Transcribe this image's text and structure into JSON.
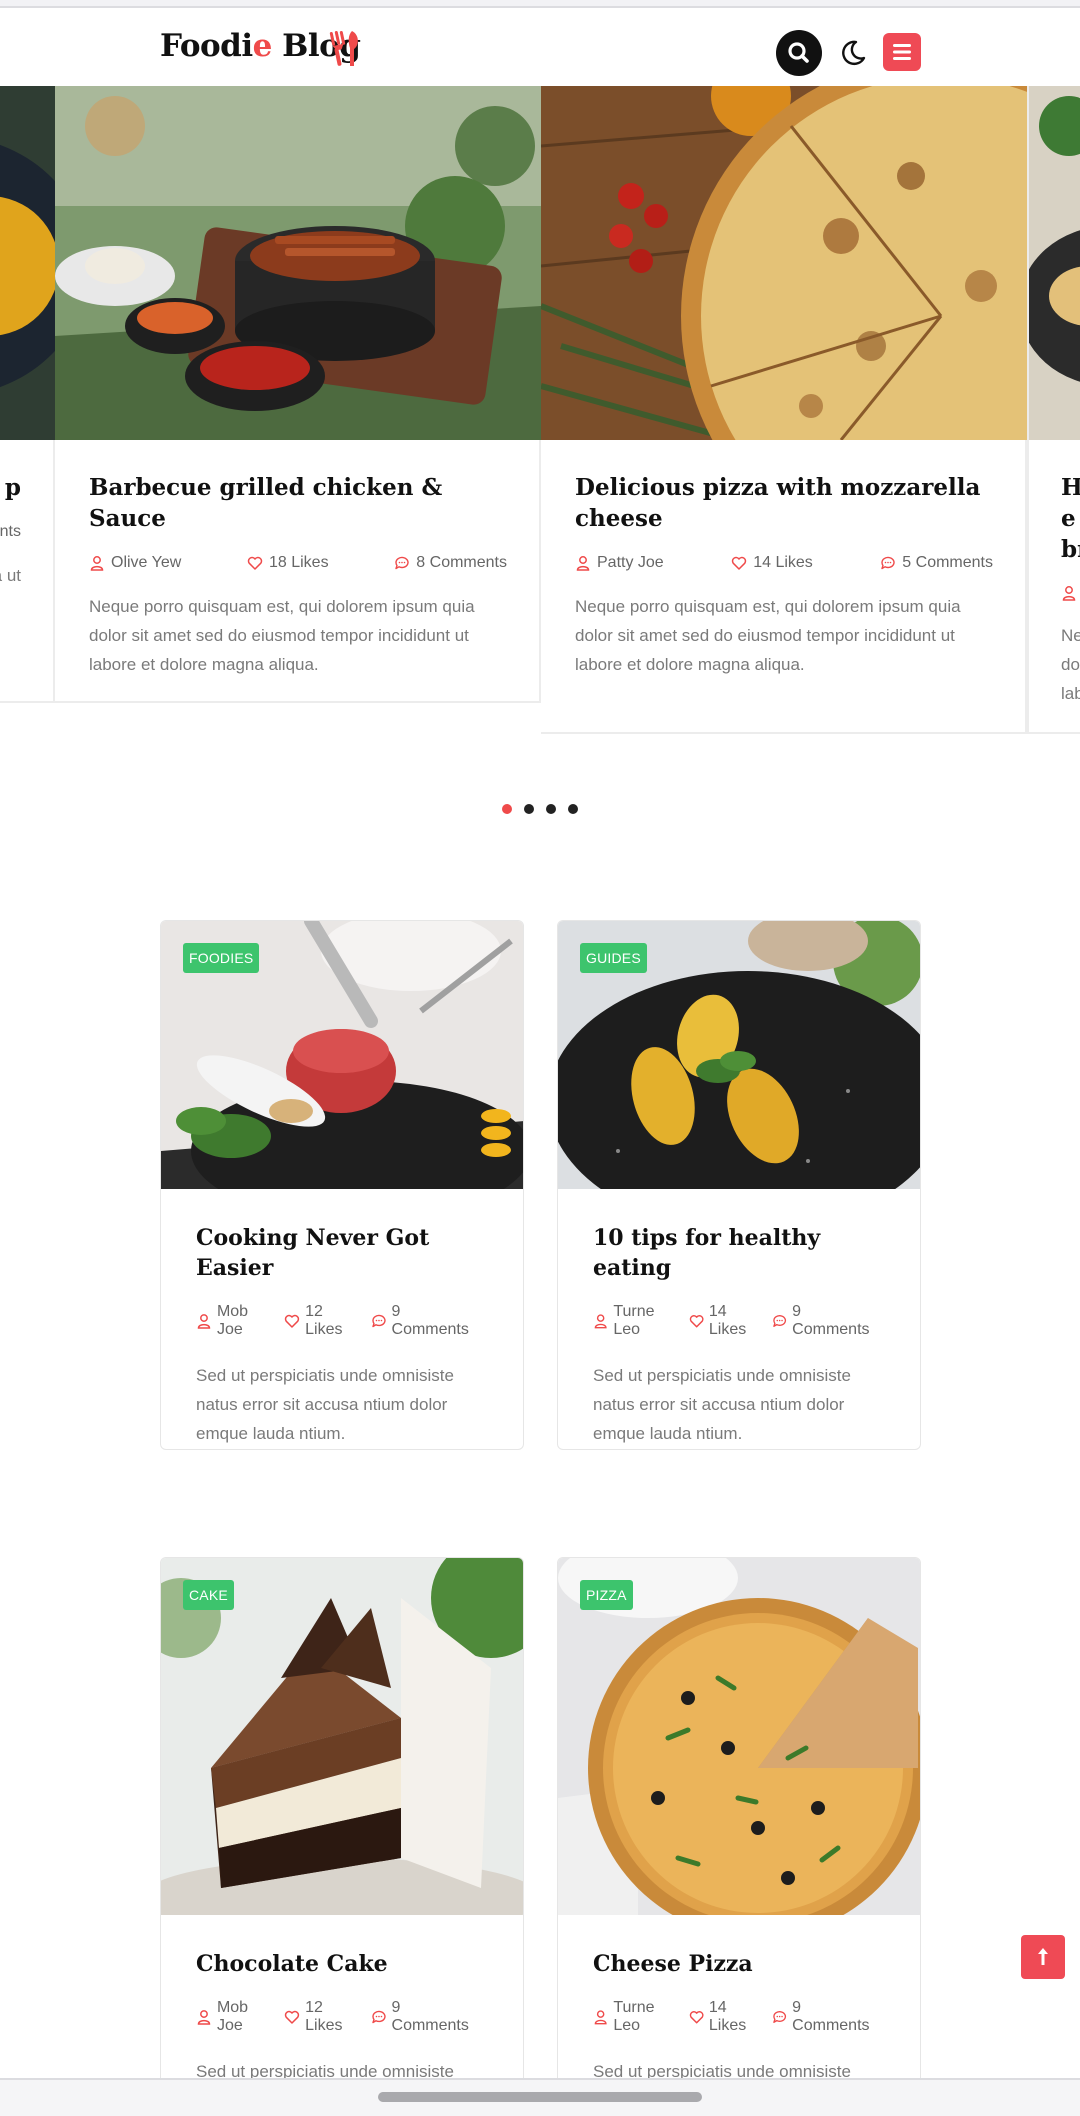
{
  "header": {
    "logo_main": "Foodi",
    "logo_accent": "e",
    "logo_end": " Blog",
    "icons": [
      "utensils-icon",
      "search-icon",
      "moon-icon",
      "menu-icon"
    ],
    "accent_color": "#ef4a55"
  },
  "slider": {
    "slides": [
      {
        "title": "Barbecue grilled chicken & Sauce",
        "author": "Olive Yew",
        "likes": "18 Likes",
        "comments": "8 Comments",
        "excerpt": "Neque porro quisquam est, qui dolorem ipsum quia dolor sit amet sed do eiusmod tempor incididunt ut labore et dolore magna aliqua."
      },
      {
        "title": "Delicious pizza with mozzarella cheese",
        "author": "Patty Joe",
        "likes": "14 Likes",
        "comments": "5 Comments",
        "excerpt": "Neque porro quisquam est, qui dolorem ipsum quia dolor sit amet sed do eiusmod tempor incididunt ut labore et dolore magna aliqua."
      }
    ],
    "left_peek": {
      "title": "p",
      "comments": "nts",
      "excerpt": "a ut"
    },
    "right_peek": {
      "title": "He br",
      "excerpt": "Ne do lab"
    },
    "dot_count": 4,
    "active_dot": 1
  },
  "posts": [
    {
      "badge": "FOODIES",
      "title": "Cooking Never Got Easier",
      "author": "Mob Joe",
      "likes": "12 Likes",
      "comments": "9 Comments",
      "excerpt": "Sed ut perspiciatis unde omnisiste natus error sit accusa ntium dolor emque lauda ntium."
    },
    {
      "badge": "GUIDES",
      "title": "10 tips for healthy eating",
      "author": "Turne Leo",
      "likes": "14 Likes",
      "comments": "9 Comments",
      "excerpt": "Sed ut perspiciatis unde omnisiste natus error sit accusa ntium dolor emque lauda ntium."
    },
    {
      "badge": "CAKE",
      "title": "Chocolate Cake",
      "author": "Mob Joe",
      "likes": "12 Likes",
      "comments": "9 Comments",
      "excerpt": "Sed ut perspiciatis unde omnisiste"
    },
    {
      "badge": "PIZZA",
      "title": "Cheese Pizza",
      "author": "Turne Leo",
      "likes": "14 Likes",
      "comments": "9 Comments",
      "excerpt": "Sed ut perspiciatis unde omnisiste"
    }
  ],
  "back_to_top_icon": "arrow-up-icon",
  "badge_color": "#3dc46d"
}
